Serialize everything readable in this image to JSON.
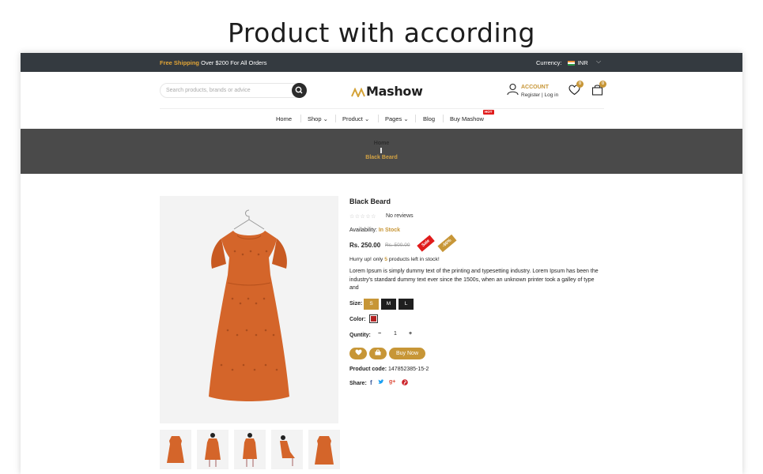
{
  "heading": "Product with according",
  "topbar": {
    "promo_highlight": "Free Shipping",
    "promo_text": "Over $200 For All Orders",
    "currency_label": "Currency:",
    "currency_value": "INR"
  },
  "header": {
    "search_placeholder": "Search products, brands or advice",
    "logo_text": "Mashow",
    "account_label": "ACCOUNT",
    "register": "Register",
    "login": "Log in",
    "wishlist_count": "0",
    "cart_count": "0"
  },
  "nav": {
    "items": [
      "Home",
      "Shop",
      "Product",
      "Pages",
      "Blog",
      "Buy Mashow"
    ],
    "hot_badge": "HOT"
  },
  "breadcrumb": {
    "home": "Home",
    "current": "Black Beard"
  },
  "product": {
    "title": "Black Beard",
    "reviews": "No reviews",
    "availability_label": "Availability:",
    "availability_value": "In Stock",
    "price": "Rs. 250.00",
    "old_price": "Rs. 500.00",
    "sale_badge": "Sale",
    "discount_badge": "-50%",
    "hurry_prefix": "Hurry up! only",
    "hurry_count": "5",
    "hurry_suffix": "products left in stock!",
    "description": "Lorem Ipsum is simply dummy text of the printing and typesetting industry. Lorem Ipsum has been the industry's standard dummy text ever since the 1500s, when an unknown printer took a galley of type and",
    "size_label": "Size:",
    "sizes": [
      "S",
      "M",
      "L"
    ],
    "color_label": "Color:",
    "quantity_label": "Quntity:",
    "quantity_value": "1",
    "buy_now": "Buy Now",
    "code_label": "Product code:",
    "code_value": "147852385-15-2",
    "share_label": "Share:"
  },
  "colors": {
    "accent": "#c79637",
    "topbar": "#343a40",
    "banner": "#4a4a4a",
    "dress": "#d4652a",
    "sale": "#e01b1b"
  }
}
